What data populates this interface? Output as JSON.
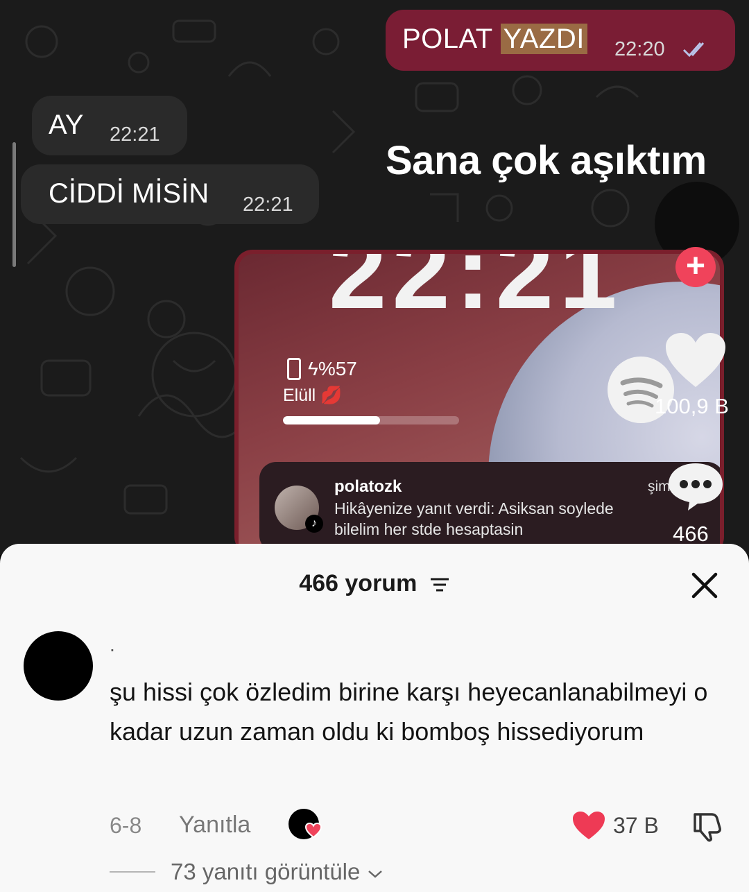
{
  "chat": {
    "outgoing": {
      "text_plain": "POLAT",
      "text_highlight": "YAZDI",
      "time": "22:20"
    },
    "incoming": [
      {
        "text": "AY",
        "time": "22:21"
      },
      {
        "text": "CİDDİ MİSİN",
        "time": "22:21"
      }
    ],
    "caption": "Sana çok aşıktım"
  },
  "story": {
    "clock": "22:21",
    "battery": "ϟ%57",
    "song": "Elüll 💋",
    "progress": 0.55,
    "notification": {
      "user": "polatozk",
      "message": "Hikâyenize yanıt verdi: Asiksan soylede bilelim her stde hesaptasin",
      "side_text": "şim"
    }
  },
  "rail": {
    "likes": "100,9 B",
    "comments": "466"
  },
  "comments_sheet": {
    "title": "466 yorum",
    "comment": {
      "username": ".",
      "text": "şu hissi çok özledim birine karşı heyecanlanabilmeyi o kadar uzun zaman oldu ki bomboş hissediyorum",
      "date": "6-8",
      "reply_label": "Yanıtla",
      "likes": "37 B",
      "view_replies": "73 yanıtı görüntüle"
    }
  },
  "colors": {
    "accent_red": "#f0435b",
    "outgoing_bubble": "#7a1d34",
    "incoming_bubble": "#2a2a2a",
    "sheet_bg": "#f8f8f8"
  },
  "icons": [
    "read-ticks-icon",
    "battery-icon",
    "plus-icon",
    "spotify-icon",
    "heart-icon",
    "comment-dots-icon",
    "sort-icon",
    "close-icon",
    "dislike-icon",
    "chevron-down-icon"
  ]
}
